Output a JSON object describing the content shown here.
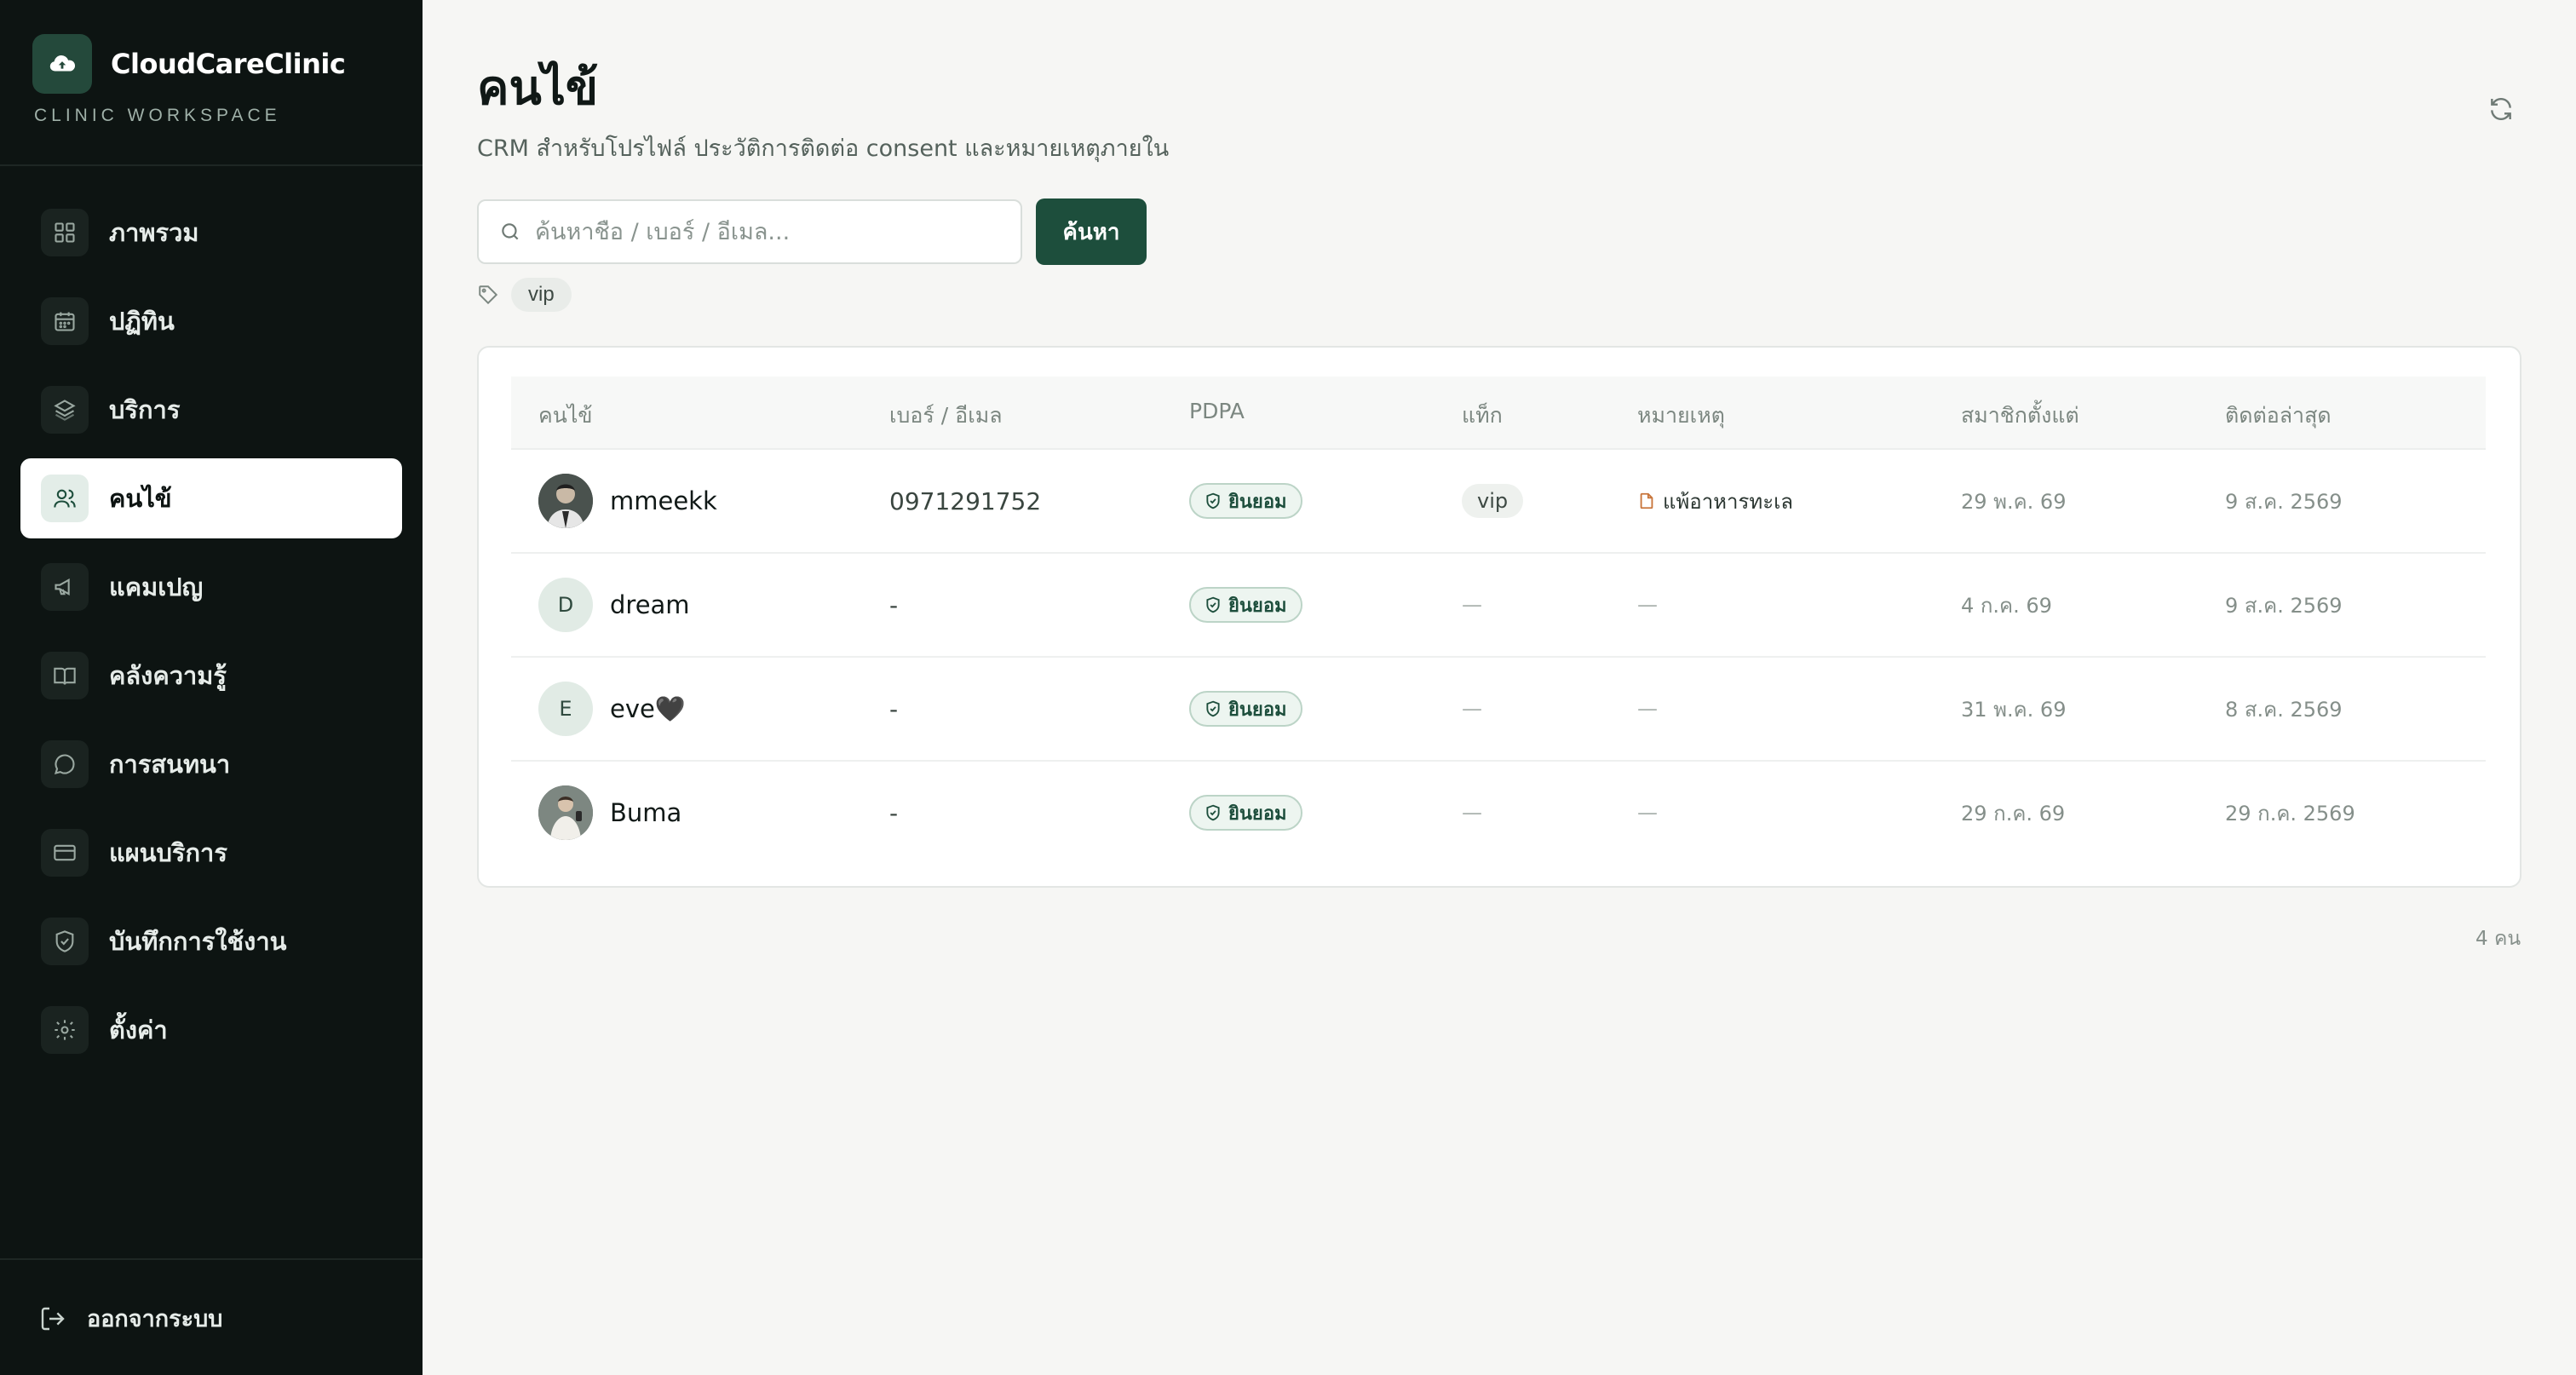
{
  "brand": {
    "name": "CloudCareClinic",
    "subtitle": "CLINIC WORKSPACE"
  },
  "nav": [
    {
      "label": "ภาพรวม",
      "icon": "grid-icon"
    },
    {
      "label": "ปฏิทิน",
      "icon": "calendar-icon"
    },
    {
      "label": "บริการ",
      "icon": "layers-icon"
    },
    {
      "label": "คนไข้",
      "icon": "users-icon",
      "active": true
    },
    {
      "label": "แคมเปญ",
      "icon": "megaphone-icon"
    },
    {
      "label": "คลังความรู้",
      "icon": "book-icon"
    },
    {
      "label": "การสนทนา",
      "icon": "chat-icon"
    },
    {
      "label": "แผนบริการ",
      "icon": "credit-card-icon"
    },
    {
      "label": "บันทึกการใช้งาน",
      "icon": "shield-icon"
    },
    {
      "label": "ตั้งค่า",
      "icon": "gear-icon"
    }
  ],
  "logout": {
    "label": "ออกจากระบบ",
    "icon": "logout-icon"
  },
  "page": {
    "title": "คนไข้",
    "subtitle": "CRM สำหรับโปรไฟล์ ประวัติการติดต่อ consent และหมายเหตุภายใน"
  },
  "search": {
    "placeholder": "ค้นหาชื่อ / เบอร์ / อีเมล...",
    "value": "",
    "button_label": "ค้นหา"
  },
  "tag_filter": {
    "icon": "tag-icon",
    "tags": [
      "vip"
    ]
  },
  "table": {
    "columns": [
      "คนไข้",
      "เบอร์ / อีเมล",
      "PDPA",
      "แท็ก",
      "หมายเหตุ",
      "สมาชิกตั้งแต่",
      "ติดต่อล่าสุด"
    ],
    "rows": [
      {
        "avatar": "photo",
        "initial": "",
        "name": "mmeekk",
        "contact": "0971291752",
        "pdpa": "ยินยอม",
        "tag": "vip",
        "note": "แพ้อาหารทะเล",
        "member_since": "29 พ.ค. 69",
        "last_contact": "9 ส.ค. 2569"
      },
      {
        "avatar": "initial",
        "initial": "D",
        "name": "dream",
        "contact": "-",
        "pdpa": "ยินยอม",
        "tag": "—",
        "note": "—",
        "member_since": "4 ก.ค. 69",
        "last_contact": "9 ส.ค. 2569"
      },
      {
        "avatar": "initial",
        "initial": "E",
        "name": "eve🖤",
        "contact": "-",
        "pdpa": "ยินยอม",
        "tag": "—",
        "note": "—",
        "member_since": "31 พ.ค. 69",
        "last_contact": "8 ส.ค. 2569"
      },
      {
        "avatar": "photo",
        "initial": "",
        "name": "Buma",
        "contact": "-",
        "pdpa": "ยินยอม",
        "tag": "—",
        "note": "—",
        "member_since": "29 ก.ค. 69",
        "last_contact": "29 ก.ค. 2569"
      }
    ]
  },
  "footer": {
    "count_label": "4 คน"
  },
  "colors": {
    "sidebar_bg": "#0d1412",
    "accent": "#1d4e3c",
    "page_bg": "#f6f6f4",
    "note_icon": "#c8743a"
  }
}
